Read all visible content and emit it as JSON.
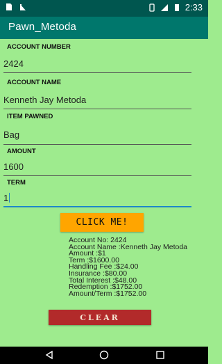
{
  "status_bar": {
    "time": "2:33",
    "left_icons": [
      "sim-card-icon",
      "no-signal-icon"
    ],
    "right_icons": [
      "vibrate-icon",
      "signal-icon",
      "battery-icon"
    ]
  },
  "app_bar": {
    "title": "Pawn_Metoda"
  },
  "form": {
    "account_number": {
      "label": "ACCOUNT NUMBER",
      "value": "2424"
    },
    "account_name": {
      "label": "ACCOUNT NAME",
      "value": "Kenneth Jay Metoda"
    },
    "item_pawned": {
      "label": "ITEM PAWNED",
      "value": "Bag"
    },
    "amount": {
      "label": "AMOUNT",
      "value": "1600"
    },
    "term": {
      "label": "TERM",
      "value": "1"
    }
  },
  "buttons": {
    "click_label": "CLICK ME!",
    "clear_label": "CLEAR"
  },
  "result": {
    "lines": [
      "Account No: 2424",
      "Account Name :Kenneth Jay Metoda",
      "Amount :$1",
      "Term :$1600.00",
      "Handling Fee :$24.00",
      "Insurance :$80.00",
      "Total Interest :$48.00",
      "Redemption :$1752.00",
      "Amount/Term :$1752.00"
    ]
  },
  "nav_bar": {
    "icons": [
      "back-icon",
      "home-icon",
      "recents-icon"
    ]
  },
  "colors": {
    "background": "#9EEB8E",
    "status_bar": "#00564F",
    "app_bar": "#00776C",
    "click_button": "#FFA500",
    "clear_button": "#B22A2A",
    "focus_underline": "#1E88C8"
  }
}
